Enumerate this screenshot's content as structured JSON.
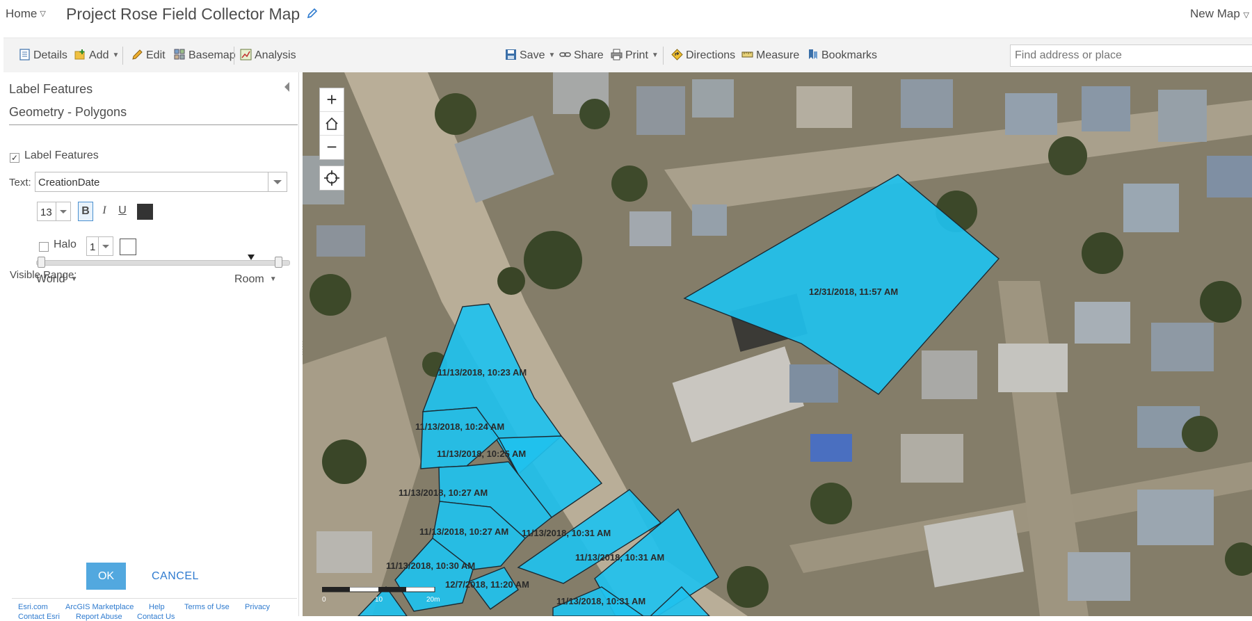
{
  "titlebar": {
    "home": "Home",
    "map_title": "Project Rose Field Collector Map",
    "new_map": "New Map"
  },
  "toolbar": {
    "details": "Details",
    "add": "Add",
    "edit": "Edit",
    "basemap": "Basemap",
    "analysis": "Analysis",
    "save": "Save",
    "share": "Share",
    "print": "Print",
    "directions": "Directions",
    "measure": "Measure",
    "bookmarks": "Bookmarks",
    "search_placeholder": "Find address or place"
  },
  "panel": {
    "title": "Label Features",
    "subtitle": "Geometry - Polygons",
    "label_features_checkbox": "Label Features",
    "label_features_checked": true,
    "text_label": "Text:",
    "text_field": "CreationDate",
    "font_size": "13",
    "bold": "B",
    "italic": "I",
    "underline": "U",
    "text_color": "#333333",
    "halo_label": "Halo",
    "halo_checked": false,
    "halo_size": "1",
    "halo_color": "#ffffff",
    "visible_range_label": "Visible Range:",
    "range_min": "World",
    "range_max": "Room",
    "ok": "OK",
    "cancel": "CANCEL"
  },
  "footer": {
    "links": [
      "Esri.com",
      "ArcGIS Marketplace",
      "Help",
      "Terms of Use",
      "Privacy",
      "Contact Esri",
      "Report Abuse",
      "Contact Us"
    ]
  },
  "map": {
    "controls": {
      "zoom_in": "+",
      "zoom_out": "−"
    },
    "polygon_fill": "#1fc1ee",
    "labels": [
      "12/31/2018, 11:57 AM",
      "11/13/2018, 10:23 AM",
      "11/13/2018, 10:24 AM",
      "11/13/2018, 10:25 AM",
      "11/13/2018, 10:27 AM",
      "11/13/2018, 10:27 AM",
      "11/13/2018, 10:31 AM",
      "11/13/2018, 10:31 AM",
      "11/13/2018, 10:30 AM",
      "12/7/2018, 11:20 AM",
      "11/13/2018, 10:31 AM"
    ],
    "scale": {
      "start": "0",
      "mid": "10",
      "end": "20m"
    }
  }
}
